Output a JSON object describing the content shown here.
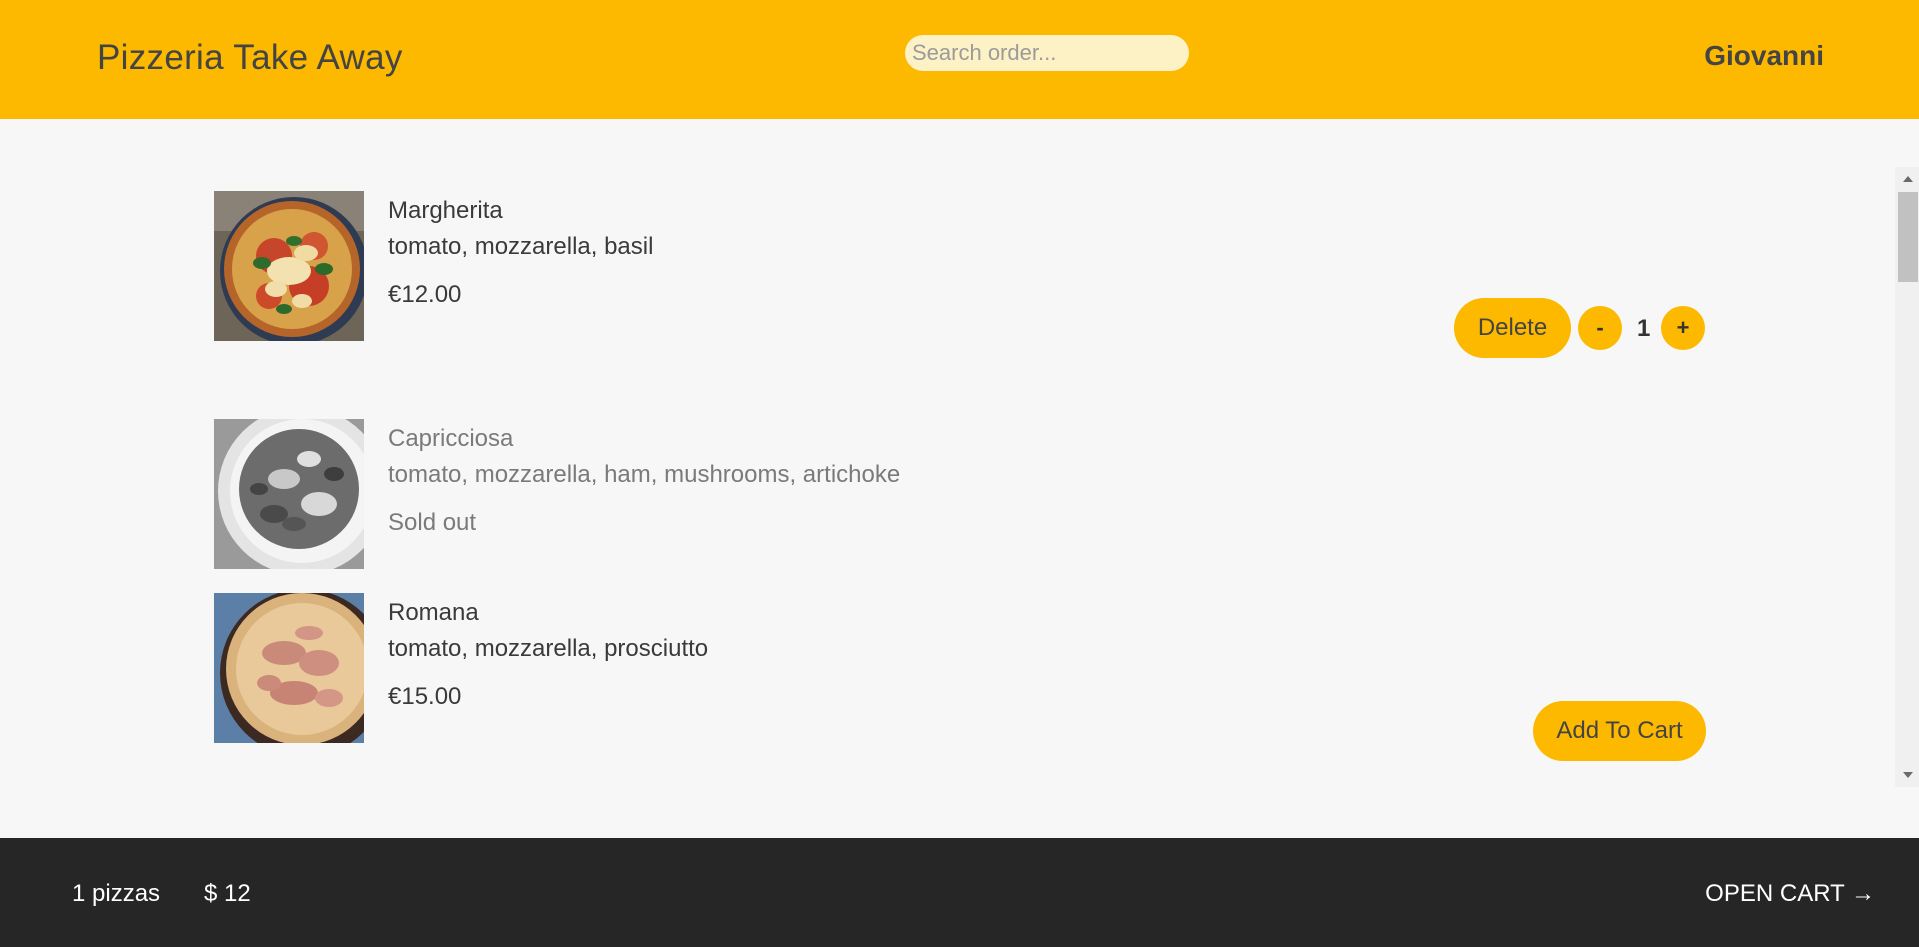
{
  "header": {
    "brand": "Pizzeria Take Away",
    "search_placeholder": "Search order...",
    "user": "Giovanni"
  },
  "menu": {
    "items": [
      {
        "name": "Margherita",
        "ingredients": "tomato, mozzarella, basil",
        "price": "€12.00",
        "in_cart": true,
        "quantity": "1",
        "delete_label": "Delete",
        "minus_label": "-",
        "plus_label": "+"
      },
      {
        "name": "Capricciosa",
        "ingredients": "tomato, mozzarella, ham, mushrooms, artichoke",
        "status": "Sold out",
        "sold_out": true
      },
      {
        "name": "Romana",
        "ingredients": "tomato, mozzarella, prosciutto",
        "price": "€15.00",
        "add_label": "Add To Cart"
      }
    ]
  },
  "footer": {
    "pizza_count": "1 pizzas",
    "total": "$ 12",
    "open_cart": "OPEN CART →"
  },
  "colors": {
    "accent": "#fdb900",
    "footer_bg": "#262626",
    "search_bg": "#fdf1c6"
  }
}
